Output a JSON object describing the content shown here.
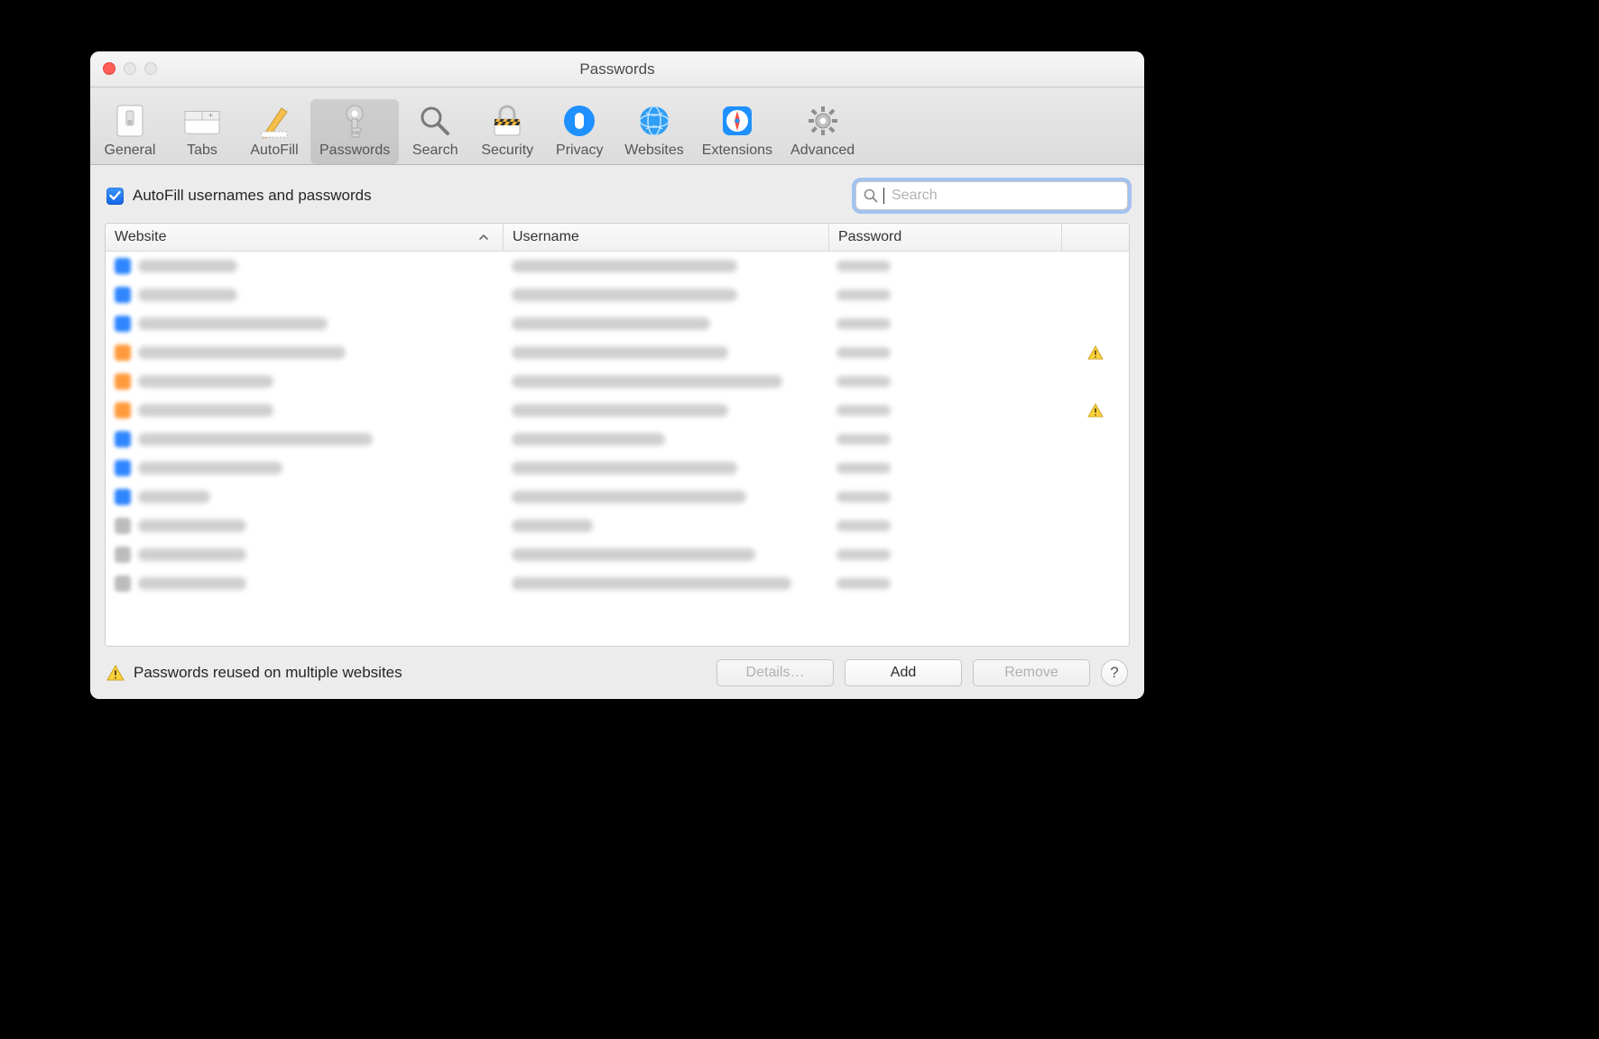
{
  "window": {
    "title": "Passwords"
  },
  "toolbar": {
    "items": [
      {
        "label": "General",
        "name": "general-icon"
      },
      {
        "label": "Tabs",
        "name": "tabs-icon"
      },
      {
        "label": "AutoFill",
        "name": "autofill-icon"
      },
      {
        "label": "Passwords",
        "name": "passwords-icon",
        "active": true
      },
      {
        "label": "Search",
        "name": "search-icon"
      },
      {
        "label": "Security",
        "name": "security-icon"
      },
      {
        "label": "Privacy",
        "name": "privacy-icon"
      },
      {
        "label": "Websites",
        "name": "websites-icon"
      },
      {
        "label": "Extensions",
        "name": "extensions-icon"
      },
      {
        "label": "Advanced",
        "name": "advanced-icon"
      }
    ]
  },
  "options": {
    "autofill_checkbox": {
      "checked": true,
      "label": "AutoFill usernames and passwords"
    },
    "search": {
      "placeholder": "Search",
      "value": ""
    }
  },
  "table": {
    "columns": {
      "website": "Website",
      "username": "Username",
      "password": "Password"
    },
    "sort": {
      "column": "website",
      "direction": "asc"
    },
    "rows": [
      {
        "favicon": "blue",
        "warning": false
      },
      {
        "favicon": "blue",
        "warning": false
      },
      {
        "favicon": "blue",
        "warning": false
      },
      {
        "favicon": "orange",
        "warning": true
      },
      {
        "favicon": "orange",
        "warning": false
      },
      {
        "favicon": "orange",
        "warning": true
      },
      {
        "favicon": "blue",
        "warning": false
      },
      {
        "favicon": "blue",
        "warning": false
      },
      {
        "favicon": "blue",
        "warning": false
      },
      {
        "favicon": "grey",
        "warning": false
      },
      {
        "favicon": "grey",
        "warning": false
      },
      {
        "favicon": "grey",
        "warning": false
      }
    ]
  },
  "footer": {
    "warning_label": "Passwords reused on multiple websites",
    "buttons": {
      "details": "Details…",
      "add": "Add",
      "remove": "Remove"
    },
    "help": "?"
  }
}
